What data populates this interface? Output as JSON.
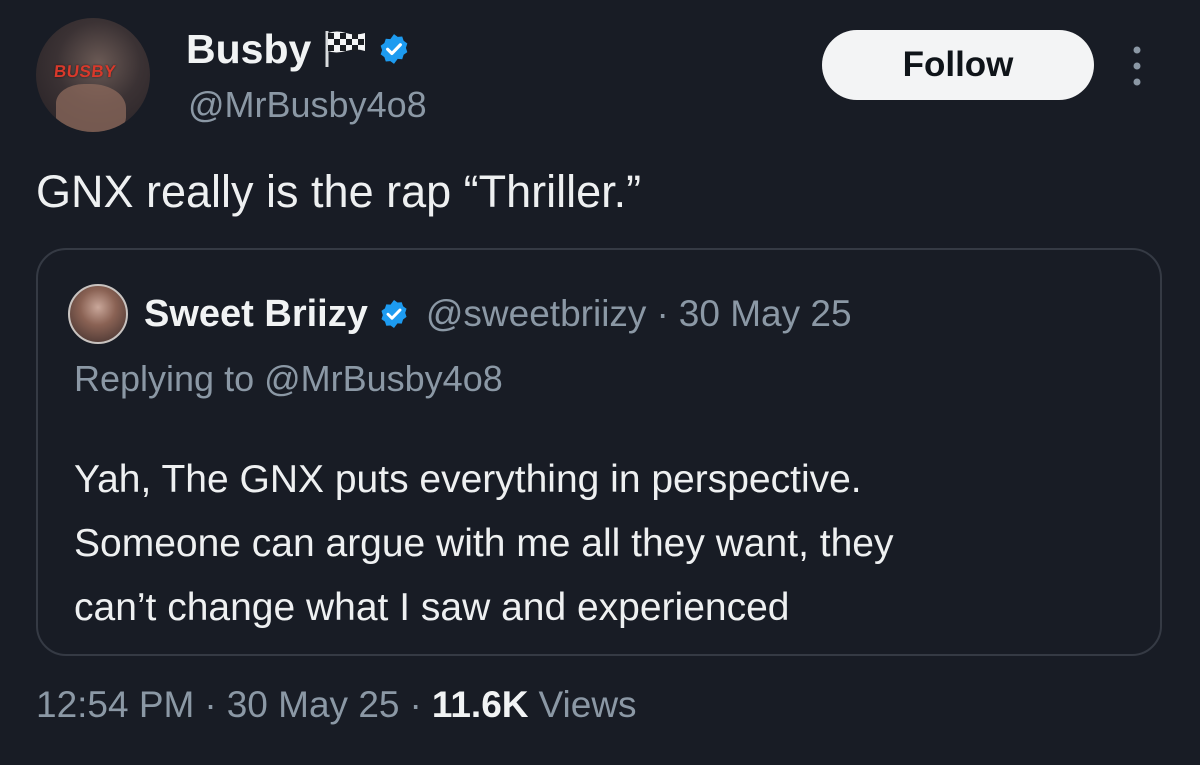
{
  "author": {
    "display_name": "Busby",
    "handle": "@MrBusby4o8",
    "avatar_logo_text": "BUSBY",
    "flag_icon": "checkered-flag-icon",
    "verified_icon": "verified-badge-icon",
    "verified_color": "#1d9bf0"
  },
  "follow_button": {
    "label": "Follow"
  },
  "tweet": {
    "text": "GNX really is the rap “Thriller.”"
  },
  "quoted_tweet": {
    "display_name": "Sweet Briizy",
    "handle": "@sweetbriizy",
    "separator": "·",
    "date": "30 May 25",
    "replying_to": "Replying to @MrBusby4o8",
    "body_lines": [
      "Yah, The GNX puts everything in perspective.",
      "Someone can argue with me all they want, they",
      "can’t change what I saw and experienced"
    ]
  },
  "meta": {
    "time": "12:54 PM",
    "separator": "·",
    "date": "30 May 25",
    "views_count": "11.6K",
    "views_label": "Views"
  },
  "colors": {
    "background": "#181c25",
    "primary_text": "#e7e9ea",
    "secondary_text": "#8b98a5",
    "follow_bg": "#f3f4f5",
    "card_border": "#353a44"
  }
}
